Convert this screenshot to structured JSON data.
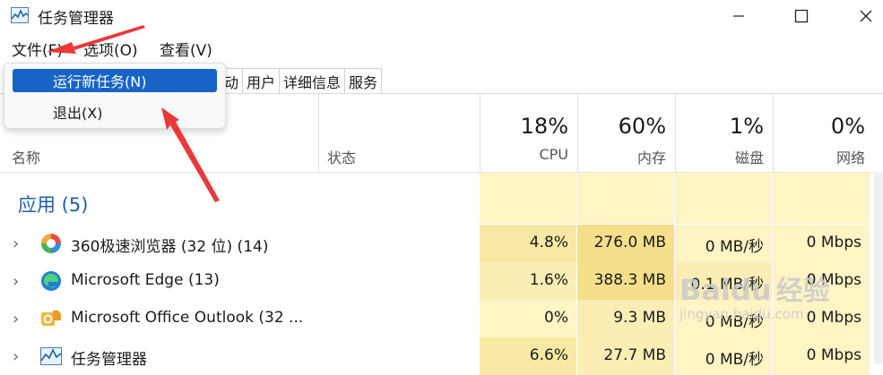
{
  "window": {
    "title": "任务管理器"
  },
  "menu": {
    "file": "文件(F)",
    "options": "选项(O)",
    "view": "查看(V)"
  },
  "dropdown": {
    "run_new": "运行新任务(N)",
    "exit": "退出(X)"
  },
  "tabs": [
    "动",
    "用户",
    "详细信息",
    "服务"
  ],
  "columns": {
    "name": "名称",
    "status": "状态",
    "cpu": {
      "pct": "18%",
      "label": "CPU"
    },
    "mem": {
      "pct": "60%",
      "label": "内存"
    },
    "disk": {
      "pct": "1%",
      "label": "磁盘"
    },
    "net": {
      "pct": "0%",
      "label": "网络"
    }
  },
  "group": "应用 (5)",
  "rows": [
    {
      "name": "360极速浏览器 (32 位) (14)",
      "cpu": "4.8%",
      "mem": "276.0 MB",
      "disk": "0 MB/秒",
      "net": "0 Mbps",
      "icon": "360-browser-icon"
    },
    {
      "name": "Microsoft Edge (13)",
      "cpu": "1.6%",
      "mem": "388.3 MB",
      "disk": "0.1 MB/秒",
      "net": "0 Mbps",
      "icon": "edge-icon"
    },
    {
      "name": "Microsoft Office Outlook (32 ...",
      "cpu": "0%",
      "mem": "9.3 MB",
      "disk": "0 MB/秒",
      "net": "0 Mbps",
      "icon": "outlook-icon"
    },
    {
      "name": "任务管理器",
      "cpu": "6.6%",
      "mem": "27.7 MB",
      "disk": "0 MB/秒",
      "net": "0 Mbps",
      "icon": "task-manager-icon"
    }
  ],
  "watermark": {
    "brand": "Baidu",
    "cn": "经验",
    "url": "jingyan.baidu.com"
  },
  "colors": {
    "accent": "#1764c6",
    "heat_light": "#fff4c4",
    "heat_mid": "#f9eca8",
    "heat_strong": "#f5df8a",
    "annotation": "#e8393b"
  }
}
